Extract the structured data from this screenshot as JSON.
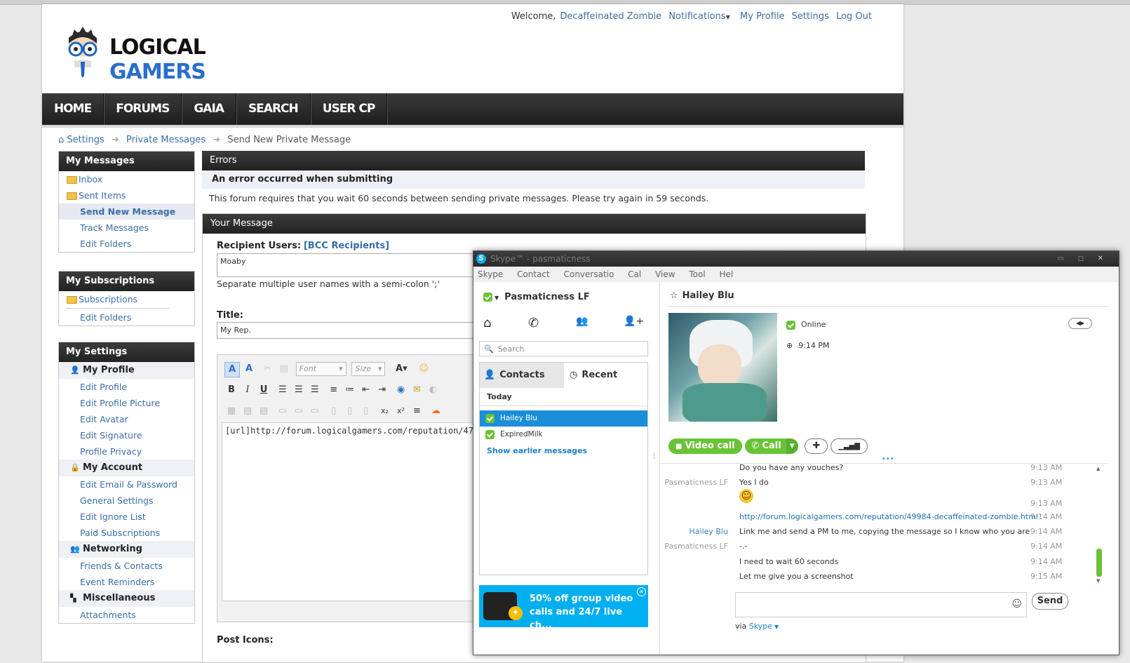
{
  "site": {
    "logo_word1": "LOGICAL",
    "logo_word2": "GAMERS",
    "welcome": "Welcome,",
    "username": "Decaffeinated Zombie",
    "notifications": "Notifications",
    "my_profile": "My Profile",
    "settings": "Settings",
    "logout": "Log Out"
  },
  "nav": [
    "HOME",
    "FORUMS",
    "GAIA",
    "SEARCH",
    "USER CP"
  ],
  "breadcrumb": [
    "Settings",
    "Private Messages",
    "Send New Private Message"
  ],
  "sidebar": {
    "messages": {
      "title": "My Messages",
      "items": [
        "Inbox",
        "Sent Items",
        "Send New Message",
        "Track Messages",
        "Edit Folders"
      ]
    },
    "subscriptions": {
      "title": "My Subscriptions",
      "items": [
        "Subscriptions",
        "Edit Folders"
      ]
    },
    "settings": {
      "title": "My Settings",
      "profile_group": "My Profile",
      "profile_items": [
        "Edit Profile",
        "Edit Profile Picture",
        "Edit Avatar",
        "Edit Signature",
        "Profile Privacy"
      ],
      "account_group": "My Account",
      "account_items": [
        "Edit Email & Password",
        "General Settings",
        "Edit Ignore List",
        "Paid Subscriptions"
      ],
      "networking_group": "Networking",
      "networking_items": [
        "Friends & Contacts",
        "Event Reminders"
      ],
      "misc_group": "Miscellaneous",
      "misc_items": [
        "Attachments"
      ]
    }
  },
  "errors": {
    "header": "Errors",
    "title": "An error occurred when submitting",
    "text": "This forum requires that you wait 60 seconds between sending private messages. Please try again in 59 seconds."
  },
  "message": {
    "header": "Your Message",
    "recipient_label": "Recipient Users:",
    "bcc": "[BCC Recipients]",
    "recipient_value": "Moaby",
    "recipient_hint": "Separate multiple user names with a semi-colon ';'",
    "title_label": "Title:",
    "title_value": "My Rep.",
    "font_select": "Font",
    "size_select": "Size",
    "body": "[url]http://forum.logicalgamers.com/reputation/47882-",
    "post_icons": "Post Icons:"
  },
  "skype": {
    "window_title": "Skype™ - pasmaticness",
    "menu": [
      "Skype",
      "Contact",
      "Conversatio",
      "Cal",
      "View",
      "Tool",
      "Hel"
    ],
    "self_name": "Pasmaticness LF",
    "search_placeholder": "Search",
    "tab_contacts": "Contacts",
    "tab_recent": "Recent",
    "section_today": "Today",
    "contacts": [
      "Hailey Blu",
      "ExpiredMilk"
    ],
    "show_earlier": "Show earlier messages",
    "ad_text": "50% off group video calls and 24/7 live ch...",
    "contact_name": "Hailey Blu",
    "status": "Online",
    "local_time": "9:14 PM",
    "btn_video": "Video call",
    "btn_call": "Call",
    "messages": [
      {
        "who": "",
        "text": "Do you have any vouches?",
        "time": "9:13 AM"
      },
      {
        "who": "Pasmaticness LF",
        "text": "Yes I do",
        "time": "9:13 AM"
      },
      {
        "who": "",
        "text": "",
        "time": "9:13 AM"
      },
      {
        "who": "",
        "text": "http://forum.logicalgamers.com/reputation/49984-decaffeinated-zombie.html",
        "time": "9:14 AM"
      },
      {
        "who": "Hailey Blu",
        "text": "Link me and send a PM to me, copying the message so I know who you are",
        "time": "9:14 AM"
      },
      {
        "who": "Pasmaticness LF",
        "text": "-.-",
        "time": "9:14 AM"
      },
      {
        "who": "",
        "text": "I need to wait 60 seconds",
        "time": "9:14 AM"
      },
      {
        "who": "",
        "text": "Let me give you a screenshot",
        "time": "9:15 AM"
      }
    ],
    "send": "Send",
    "via": "via",
    "via_link": "Skype"
  },
  "colors": {
    "accent_blue": "#2a6fc9",
    "link": "#3a6ea8",
    "skype_green": "#6ac336",
    "skype_blue": "#00aff0"
  }
}
